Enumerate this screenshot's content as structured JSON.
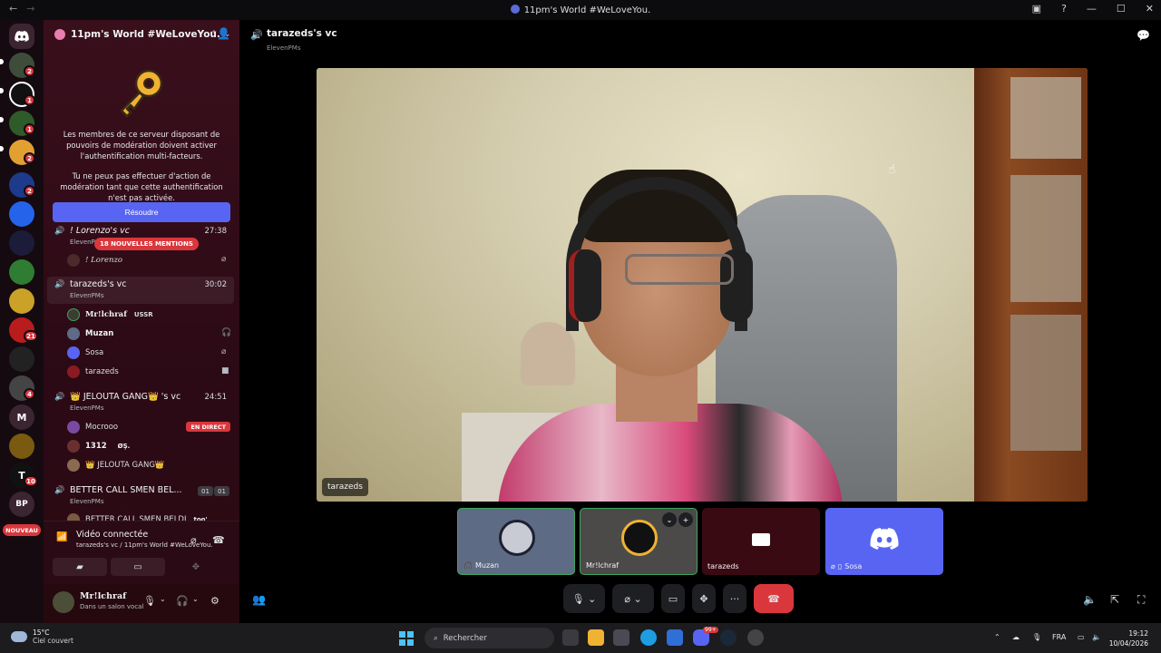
{
  "titlebar": {
    "title": "11pm's World #WeLoveYou.",
    "back": "←",
    "forward": "→"
  },
  "rail": {
    "badges": [
      "2",
      "1",
      "1",
      "2",
      "2",
      "21",
      "4",
      "10"
    ],
    "letter_m": "M",
    "letter_t": "T",
    "letter_bp": "BP",
    "nouveau": "NOUVEAU"
  },
  "server": {
    "name": "11pm's World #WeLoveYou.",
    "mfa_text_1": "Les membres de ce serveur disposant de pouvoirs de modération doivent activer l'authentification multi-facteurs.",
    "mfa_text_2": "Tu ne peux pas effectuer d'action de modération tant que cette authentification n'est pas activée.",
    "resolve_label": "Résoudre",
    "mentions_label": "18 NOUVELLES MENTIONS"
  },
  "channels": [
    {
      "name": "! Lorenzo's vc",
      "sub": "ElevenPMs",
      "time": "27:38",
      "members": [
        {
          "name": "! Lorenzo"
        }
      ]
    },
    {
      "name": "tarazeds's vc",
      "sub": "ElevenPMs",
      "time": "30:02",
      "members": [
        {
          "name": "Mr!lchraf",
          "tag": "USSR"
        },
        {
          "name": "Muzan"
        },
        {
          "name": "Sosa"
        },
        {
          "name": "tarazeds"
        }
      ]
    },
    {
      "name": "👑 JELOUTA GANG👑 's vc",
      "sub": "ElevenPMs",
      "time": "24:51",
      "members": [
        {
          "name": "Mocrooo",
          "badge": "EN DIRECT"
        },
        {
          "name": "1312",
          "tag": "ØŞ."
        },
        {
          "name": "👑 JELOUTA GANG👑"
        }
      ]
    },
    {
      "name": "BETTER CALL SMEN BEL...",
      "sub": "ElevenPMs",
      "counts": [
        "01",
        "01"
      ],
      "members": [
        {
          "name": "BETTER CALL SMEN BELDI",
          "tag": "too'"
        }
      ]
    }
  ],
  "voice_panel": {
    "title": "Vidéo connectée",
    "sub": "tarazeds's vc / 11pm's World #WeLoveYou."
  },
  "user": {
    "name": "Mr!lchraf",
    "status": "Dans un salon vocal"
  },
  "call": {
    "channel": "tarazeds's vc",
    "sub": "ElevenPMs",
    "main_label": "tarazeds",
    "tiles": [
      {
        "name": "Muzan"
      },
      {
        "name": "Mr!lchraf"
      },
      {
        "name": "tarazeds"
      },
      {
        "name": "Sosa"
      }
    ]
  },
  "taskbar": {
    "temp": "15°C",
    "weather": "Ciel couvert",
    "search": "Rechercher",
    "lang": "FRA",
    "time": "19:12",
    "date": "10/04/2026",
    "discord_badge": "99+"
  },
  "colors": {
    "accent": "#5865f2",
    "danger": "#da373c",
    "speaking": "#3ba55d",
    "sidebar": "#3a0f1c"
  }
}
